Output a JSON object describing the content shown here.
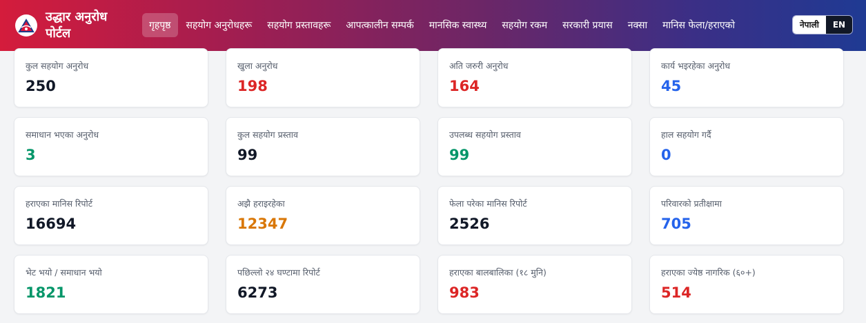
{
  "header": {
    "title": "उद्धार अनुरोध पोर्टल",
    "nav": [
      {
        "label": "गृहपृष्ठ",
        "active": true
      },
      {
        "label": "सहयोग अनुरोधहरू"
      },
      {
        "label": "सहयोग प्रस्तावहरू"
      },
      {
        "label": "आपत्कालीन सम्पर्क"
      },
      {
        "label": "मानसिक स्वास्थ्य"
      },
      {
        "label": "सहयोग रकम"
      },
      {
        "label": "सरकारी प्रयास"
      },
      {
        "label": "नक्सा"
      },
      {
        "label": "मानिस फेला/हराएको"
      }
    ],
    "lang": {
      "np": "नेपाली",
      "en": "EN"
    }
  },
  "colors": {
    "dark": "#111827",
    "red": "#dc2626",
    "blue": "#2563eb",
    "green": "#059669",
    "orange": "#d97706"
  },
  "stats": [
    {
      "label": "कुल सहयोग अनुरोध",
      "value": "250",
      "color": "dark"
    },
    {
      "label": "खुला अनुरोध",
      "value": "198",
      "color": "red"
    },
    {
      "label": "अति जरुरी अनुरोध",
      "value": "164",
      "color": "red"
    },
    {
      "label": "कार्य भइरहेका अनुरोध",
      "value": "45",
      "color": "blue"
    },
    {
      "label": "समाधान भएका अनुरोध",
      "value": "3",
      "color": "green"
    },
    {
      "label": "कुल सहयोग प्रस्ताव",
      "value": "99",
      "color": "dark"
    },
    {
      "label": "उपलब्ध सहयोग प्रस्ताव",
      "value": "99",
      "color": "green"
    },
    {
      "label": "हाल सहयोग गर्दै",
      "value": "0",
      "color": "blue"
    },
    {
      "label": "हराएका मानिस रिपोर्ट",
      "value": "16694",
      "color": "dark"
    },
    {
      "label": "अझै हराइरहेका",
      "value": "12347",
      "color": "orange"
    },
    {
      "label": "फेला परेका मानिस रिपोर्ट",
      "value": "2526",
      "color": "dark"
    },
    {
      "label": "परिवारको प्रतीक्षामा",
      "value": "705",
      "color": "blue"
    },
    {
      "label": "भेट भयो / समाधान भयो",
      "value": "1821",
      "color": "green"
    },
    {
      "label": "पछिल्लो २४ घण्टामा रिपोर्ट",
      "value": "6273",
      "color": "dark"
    },
    {
      "label": "हराएका बालबालिका (१८ मुनि)",
      "value": "983",
      "color": "red"
    },
    {
      "label": "हराएका ज्येष्ठ नागरिक (६०+)",
      "value": "514",
      "color": "red"
    }
  ]
}
